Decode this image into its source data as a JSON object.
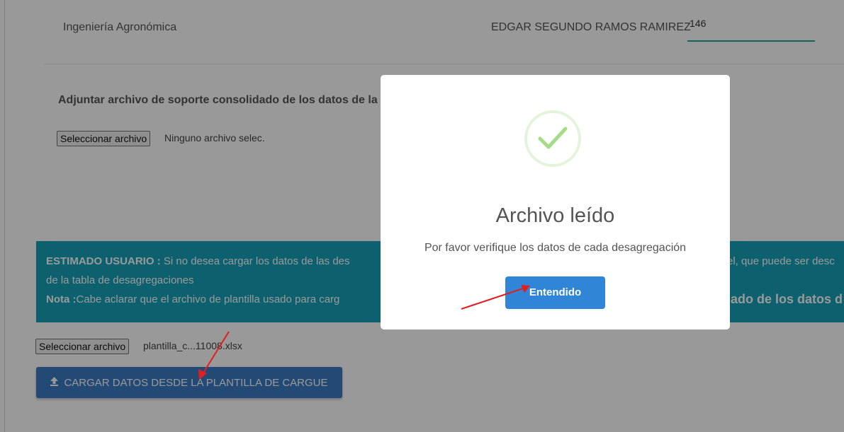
{
  "header": {
    "program": "Ingeniería Agronómica",
    "person": "EDGAR SEGUNDO RAMOS RAMIREZ",
    "field_value": "146"
  },
  "support_file": {
    "label": "Adjuntar archivo de soporte consolidado de los datos de la",
    "button_label": "Seleccionar archivo",
    "status": "Ninguno archivo selec."
  },
  "alert": {
    "line1_bold": "ESTIMADO USUARIO :",
    "line1_text": "Si no desea cargar los datos de las des",
    "line1_right": "el, que puede ser desc",
    "line2_text": "de la tabla de desagregaciones",
    "line3_bold": "Nota :",
    "line3_text": "Cabe aclarar que el archivo de plantilla usado para carg",
    "line3_right": "lado de los datos d"
  },
  "template_file": {
    "button_label": "Seleccionar archivo",
    "filename": "plantilla_c...11008.xlsx"
  },
  "upload_button": {
    "label": "CARGAR DATOS DESDE LA PLANTILLA DE CARGUE",
    "icon": "upload-icon"
  },
  "modal": {
    "icon": "success-check-icon",
    "title": "Archivo leído",
    "text": "Por favor verifique los datos de cada desagregación",
    "confirm_label": "Entendido"
  },
  "colors": {
    "alert_bg": "#17a2b8",
    "upload_btn": "#3b7ac4",
    "confirm_btn": "#3085d6",
    "success_check": "#a5dc86",
    "annotation_arrow": "#e02020"
  }
}
